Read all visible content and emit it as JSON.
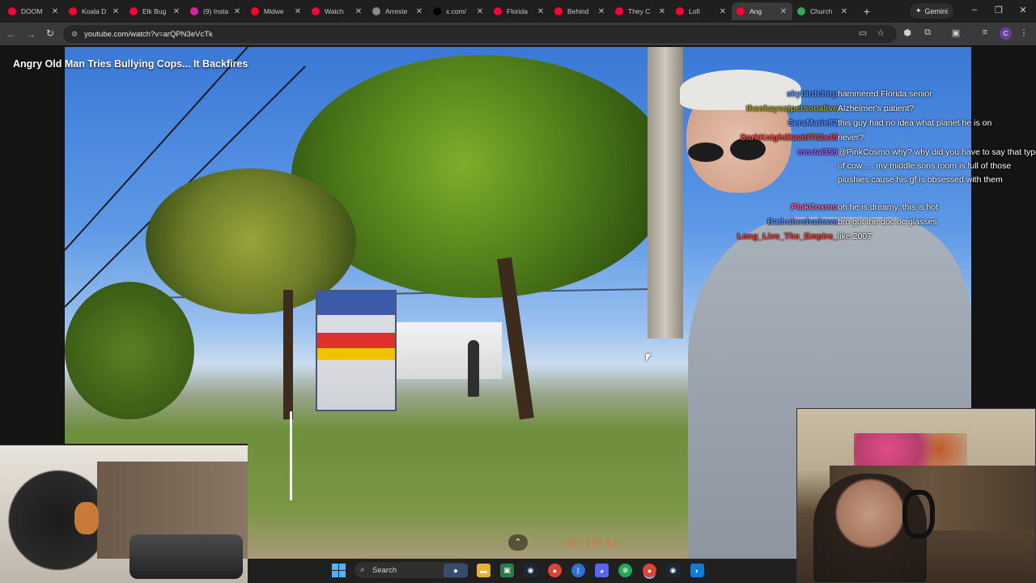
{
  "browser": {
    "tabs": [
      {
        "label": "DOOM",
        "favicon": "youtube-icon",
        "color": "#ff0033"
      },
      {
        "label": "Koala D",
        "favicon": "youtube-icon",
        "color": "#ff0033"
      },
      {
        "label": "Elk Bug",
        "favicon": "youtube-icon",
        "color": "#ff0033"
      },
      {
        "label": "(9) Insta",
        "favicon": "instagram-icon",
        "color": "#d6249f"
      },
      {
        "label": "Midwe",
        "favicon": "youtube-icon",
        "color": "#ff0033"
      },
      {
        "label": "Watch",
        "favicon": "youtube-icon",
        "color": "#ff0033"
      },
      {
        "label": "Arreste",
        "favicon": "globe-icon",
        "color": "#8a8a8a"
      },
      {
        "label": "x.com/",
        "favicon": "x-icon",
        "color": "#000000"
      },
      {
        "label": "Florida",
        "favicon": "youtube-icon",
        "color": "#ff0033"
      },
      {
        "label": "Behind",
        "favicon": "youtube-icon",
        "color": "#ff0033"
      },
      {
        "label": "They C",
        "favicon": "youtube-icon",
        "color": "#ff0033"
      },
      {
        "label": "Lofi",
        "favicon": "youtube-icon",
        "color": "#ff0033"
      },
      {
        "label": "Ang",
        "favicon": "youtube-icon",
        "color": "#ff0033",
        "active": true
      },
      {
        "label": "Church",
        "favicon": "maps-icon",
        "color": "#34a853"
      }
    ],
    "gemini_label": "Gemini",
    "url": "youtube.com/watch?v=arQPN3eVcTk"
  },
  "video": {
    "title": "Angry Old Man Tries Bullying Cops... It Backfires",
    "overlay_timestamp": "-18 10:04"
  },
  "chat": [
    {
      "user": "skybirdchirp",
      "color": "#5b8cff",
      "message": "hammered Florida senior"
    },
    {
      "user": "theokayestpersonalive",
      "color": "#a6a020",
      "message": "Alzheimer's patient?"
    },
    {
      "user": "SeraMarie82",
      "color": "#5b8cff",
      "message": "this guy had no idea what planet he is on"
    },
    {
      "user": "DarkKnightDavid762x45",
      "color": "#ff3a3a",
      "message": "never?"
    },
    {
      "user": "mortal359",
      "color": "#b05cff",
      "message": "@PinkCosmo why? why did you have to say that type of cow..... my middle sons room is full of those plushies cause his gf is obsessed with them"
    },
    {
      "user": "PinkCosmo",
      "color": "#ff5fa8",
      "message": "oh he is dreamy, this is hot"
    },
    {
      "user": "Batintheshadows",
      "color": "#5b8cff",
      "message": "bro got the doc oc glasses"
    },
    {
      "user": "Long_Live_The_Empire_",
      "color": "#ff3a3a",
      "message": "like 2007"
    }
  ],
  "taskbar": {
    "search_label": "Search"
  }
}
